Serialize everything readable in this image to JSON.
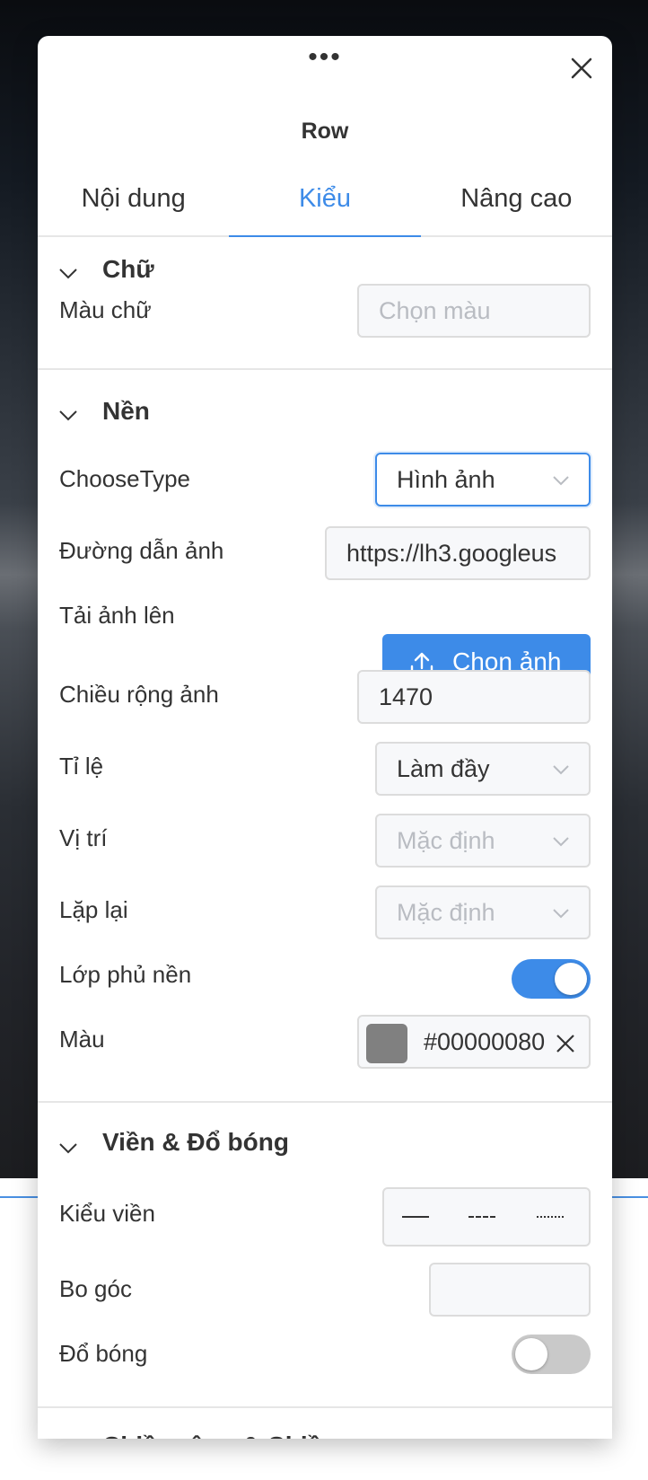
{
  "panel": {
    "title": "Row",
    "tabs": [
      {
        "label": "Nội dung",
        "active": false
      },
      {
        "label": "Kiểu",
        "active": true
      },
      {
        "label": "Nâng cao",
        "active": false
      }
    ]
  },
  "sections": {
    "text": {
      "title": "Chữ",
      "text_color_label": "Màu chữ",
      "text_color_placeholder": "Chọn màu"
    },
    "background": {
      "title": "Nền",
      "choose_type_label": "ChooseType",
      "choose_type_value": "Hình ảnh",
      "image_url_label": "Đường dẫn ảnh",
      "image_url_value": "https://lh3.googleus",
      "upload_label": "Tải ảnh lên",
      "upload_button": "Chọn ảnh",
      "image_width_label": "Chiều rộng ảnh",
      "image_width_value": "1470",
      "ratio_label": "Tỉ lệ",
      "ratio_value": "Làm đầy",
      "position_label": "Vị trí",
      "position_placeholder": "Mặc định",
      "repeat_label": "Lặp lại",
      "repeat_placeholder": "Mặc định",
      "overlay_label": "Lớp phủ nền",
      "overlay_on": true,
      "color_label": "Màu",
      "color_value": "#00000080",
      "swatch_color": "#808080"
    },
    "border": {
      "title": "Viền & Đổ bóng",
      "border_style_label": "Kiểu viền",
      "border_styles": [
        "solid",
        "dashed",
        "dotted"
      ],
      "radius_label": "Bo góc",
      "shadow_label": "Đổ bóng",
      "shadow_on": false
    },
    "size": {
      "title": "Chiều rộng & Chiều cao"
    }
  },
  "colors": {
    "accent": "#3d8be8",
    "text": "#333333"
  }
}
